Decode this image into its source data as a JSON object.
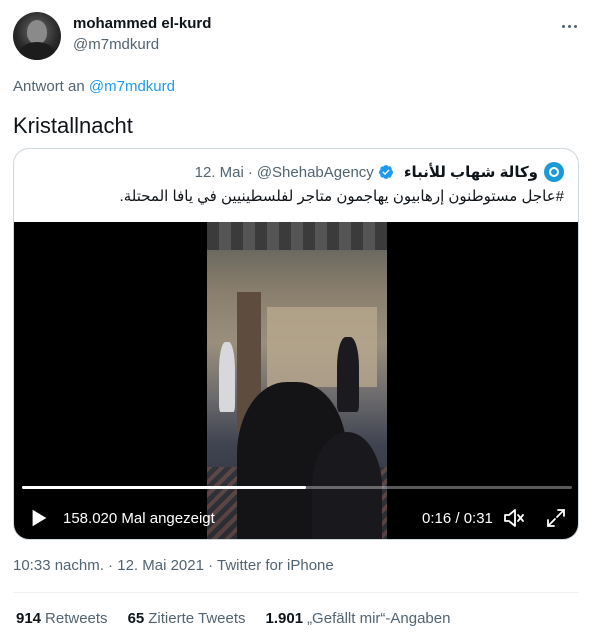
{
  "tweet": {
    "author_name": "mohammed el-kurd",
    "author_handle": "@m7mdkurd",
    "reply_prefix": "Antwort an",
    "reply_to": "@m7mdkurd",
    "text": "Kristallnacht",
    "timestamp": "10:33 nachm. · 12. Mai 2021 · ",
    "source": "Twitter for iPhone"
  },
  "quoted": {
    "name": "وكالة شهاب للأنباء",
    "handle": "@ShehabAgency",
    "date": "12. Mai",
    "separator": "·",
    "text": "#عاجل مستوطنون إرهابيون يهاجمون متاجر لفلسطينيين في يافا المحتلة."
  },
  "video": {
    "views": "158.020 Mal angezeigt",
    "time": "0:16 / 0:31",
    "progress_fraction": 0.516
  },
  "stats": [
    {
      "count": "914",
      "label": "Retweets"
    },
    {
      "count": "65",
      "label": "Zitierte Tweets"
    },
    {
      "count": "1.901",
      "label": "„Gefällt mir“-Angaben"
    }
  ],
  "icons": {
    "more": "more-horizontal-icon",
    "verified": "verified-badge-icon",
    "play": "play-icon",
    "volume": "volume-icon",
    "fullscreen": "fullscreen-icon"
  },
  "colors": {
    "accent": "#1d9bf0",
    "secondary_text": "#536471",
    "border": "#cfd9de"
  }
}
